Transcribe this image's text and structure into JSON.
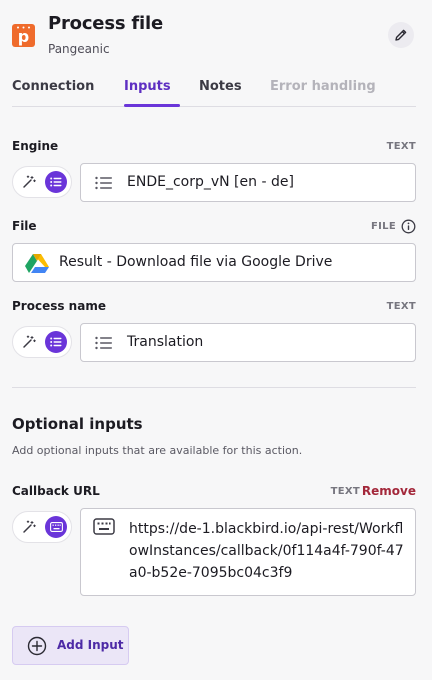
{
  "header": {
    "title": "Process file",
    "subtitle": "Pangeanic",
    "logo_letter": "p"
  },
  "tabs": [
    {
      "label": "Connection",
      "state": "normal"
    },
    {
      "label": "Inputs",
      "state": "active"
    },
    {
      "label": "Notes",
      "state": "normal"
    },
    {
      "label": "Error handling",
      "state": "disabled"
    }
  ],
  "fields": {
    "engine": {
      "label": "Engine",
      "type": "TEXT",
      "value": "ENDE_corp_vN [en - de]"
    },
    "file": {
      "label": "File",
      "type": "FILE",
      "value": "Result - Download file via Google Drive"
    },
    "process_name": {
      "label": "Process name",
      "type": "TEXT",
      "value": "Translation"
    }
  },
  "optional": {
    "title": "Optional inputs",
    "description": "Add optional inputs that are available for this action.",
    "callback_url": {
      "label": "Callback URL",
      "type": "TEXT",
      "remove_label": "Remove",
      "value": "https://de-1.blackbird.io/api-rest/WorkflowInstances/callback/0f114a4f-790f-47a0-b52e-7095bc04c3f9"
    }
  },
  "add_input_label": "Add Input",
  "colors": {
    "accent": "#6a35d9",
    "brand": "#ef6b2c",
    "remove": "#a3273a"
  }
}
